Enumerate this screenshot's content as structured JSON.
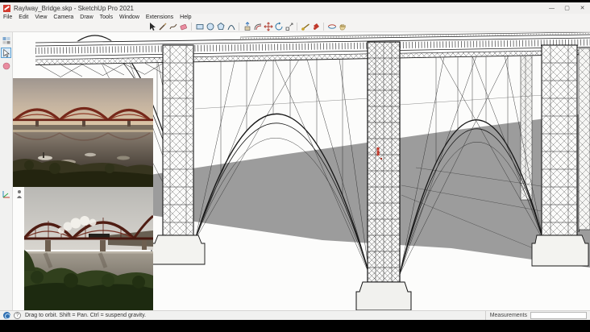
{
  "window": {
    "title": "Raylway_Bridge.skp - SketchUp Pro 2021",
    "controls": {
      "minimize": "—",
      "maximize": "▢",
      "close": "✕"
    }
  },
  "menu": {
    "items": [
      "File",
      "Edit",
      "View",
      "Camera",
      "Draw",
      "Tools",
      "Window",
      "Extensions",
      "Help"
    ]
  },
  "toolbar": {
    "tools": [
      "select",
      "line",
      "freehand",
      "eraser",
      "rectangle",
      "circle",
      "polygon",
      "two-point-arc",
      "push-pull",
      "offset",
      "move",
      "rotate",
      "scale",
      "tape-measure",
      "paint-bucket",
      "orbit",
      "pan"
    ]
  },
  "left_toolbar": {
    "tools": [
      "styles",
      "select",
      "eraser"
    ]
  },
  "floating_tools": [
    "axes",
    "person-scale"
  ],
  "viewport": {
    "model": "forth-railway-bridge-3d-model",
    "reference_photos": [
      "forth-bridge-sunset-photo",
      "forth-bridge-steam-train-photo"
    ],
    "marker_color": "#c0392b",
    "ground_color": "#9c9c9c"
  },
  "statusbar": {
    "hint": "Drag to orbit. Shift = Pan. Ctrl = suspend gravity.",
    "help_glyph": "?",
    "measurements_label": "Measurements",
    "measurements_value": ""
  }
}
